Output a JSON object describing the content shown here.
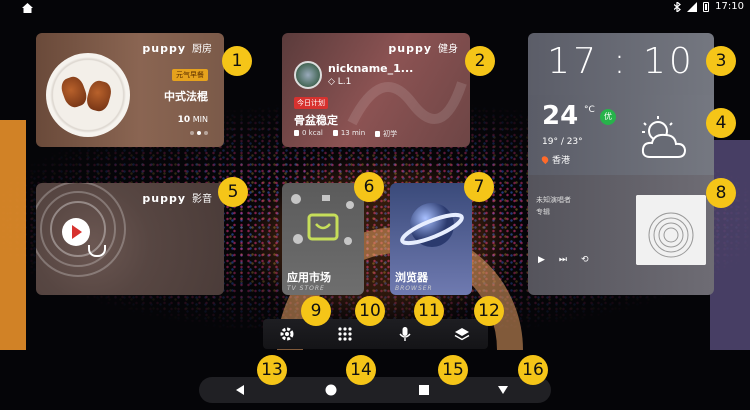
{
  "status_bar": {
    "time": "17:10"
  },
  "kitchen_card": {
    "brand": "puppy",
    "brand_cn": "厨房",
    "tag": "元气早餐",
    "title": "中式法棍",
    "duration_value": "10",
    "duration_unit": "MIN"
  },
  "fitness_card": {
    "brand": "puppy",
    "brand_cn": "健身",
    "username": "nickname_1...",
    "level": "L.1",
    "tag": "今日计划",
    "title": "骨盆稳定",
    "stats": [
      "0 kcal",
      "13 min",
      "初学"
    ]
  },
  "clock_card": {
    "time": "17 : 10"
  },
  "weather_card": {
    "temp": "24",
    "unit": "°C",
    "aqi": "优",
    "range": "19° / 23°",
    "city": "香港",
    "icon": "partly-cloudy-icon"
  },
  "music_card": {
    "artist": "未知演唱者",
    "album": "专辑",
    "controls": [
      "play-icon",
      "next-icon",
      "repeat-icon"
    ]
  },
  "video_card": {
    "brand": "puppy",
    "brand_cn": "影音"
  },
  "apps": {
    "store": {
      "label": "应用市场",
      "label_en": "TV STORE"
    },
    "browser": {
      "label": "浏览器",
      "label_en": "BROWSER"
    }
  },
  "dock": [
    "settings-icon",
    "apps-grid-icon",
    "microphone-icon",
    "layers-icon"
  ],
  "navbar": [
    "back-icon",
    "home-icon",
    "recents-icon",
    "dropdown-icon"
  ],
  "markers": [
    "1",
    "2",
    "3",
    "4",
    "5",
    "6",
    "7",
    "8",
    "9",
    "10",
    "11",
    "12",
    "13",
    "14",
    "15",
    "16"
  ]
}
